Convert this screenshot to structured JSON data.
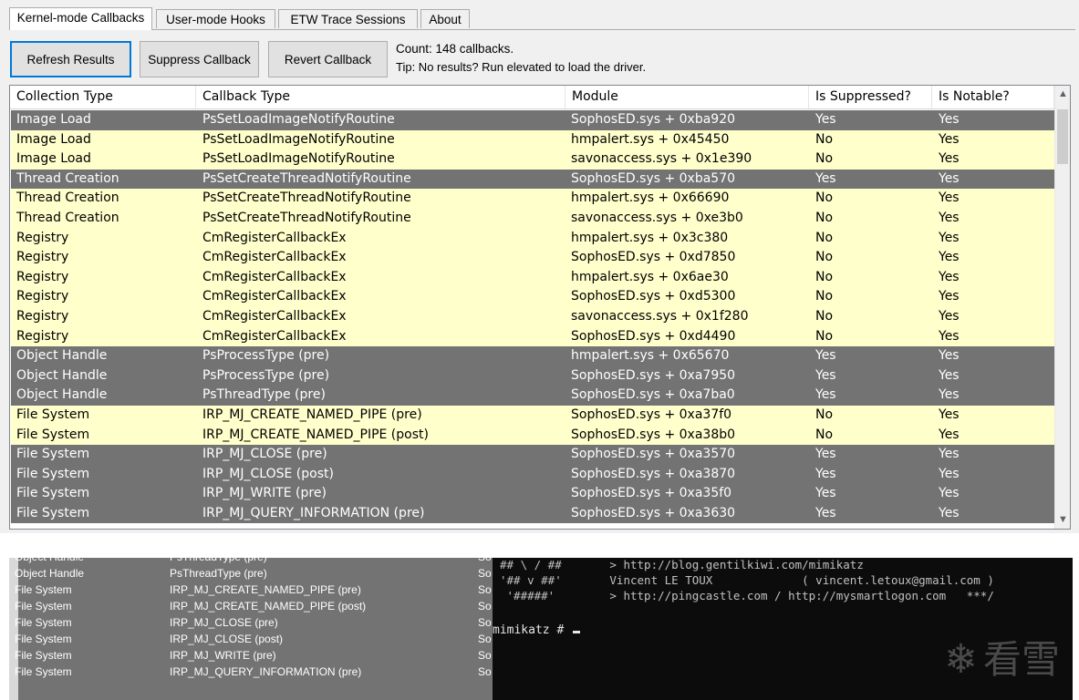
{
  "tabs": [
    "Kernel-mode Callbacks",
    "User-mode Hooks",
    "ETW Trace Sessions",
    "About"
  ],
  "toolbar": {
    "refresh_label": "Refresh Results",
    "suppress_label": "Suppress Callback",
    "revert_label": "Revert Callback",
    "count_text": "Count: 148 callbacks.",
    "tip_text": "Tip: No results? Run elevated to load the driver."
  },
  "columns": [
    "Collection Type",
    "Callback Type",
    "Module",
    "Is Suppressed?",
    "Is Notable?"
  ],
  "colors": {
    "highlight_row": "#737373",
    "notable_row": "#ffffcc"
  },
  "rows": [
    {
      "collection": "Image Load",
      "callback": "PsSetLoadImageNotifyRoutine",
      "module": "SophosED.sys + 0xba920",
      "suppressed": "Yes",
      "notable": "Yes",
      "shade": "dark"
    },
    {
      "collection": "Image Load",
      "callback": "PsSetLoadImageNotifyRoutine",
      "module": "hmpalert.sys + 0x45450",
      "suppressed": "No",
      "notable": "Yes",
      "shade": "light"
    },
    {
      "collection": "Image Load",
      "callback": "PsSetLoadImageNotifyRoutine",
      "module": "savonaccess.sys + 0x1e390",
      "suppressed": "No",
      "notable": "Yes",
      "shade": "light"
    },
    {
      "collection": "Thread Creation",
      "callback": "PsSetCreateThreadNotifyRoutine",
      "module": "SophosED.sys + 0xba570",
      "suppressed": "Yes",
      "notable": "Yes",
      "shade": "dark"
    },
    {
      "collection": "Thread Creation",
      "callback": "PsSetCreateThreadNotifyRoutine",
      "module": "hmpalert.sys + 0x66690",
      "suppressed": "No",
      "notable": "Yes",
      "shade": "light"
    },
    {
      "collection": "Thread Creation",
      "callback": "PsSetCreateThreadNotifyRoutine",
      "module": "savonaccess.sys + 0xe3b0",
      "suppressed": "No",
      "notable": "Yes",
      "shade": "light"
    },
    {
      "collection": "Registry",
      "callback": "CmRegisterCallbackEx",
      "module": "hmpalert.sys + 0x3c380",
      "suppressed": "No",
      "notable": "Yes",
      "shade": "light"
    },
    {
      "collection": "Registry",
      "callback": "CmRegisterCallbackEx",
      "module": "SophosED.sys + 0xd7850",
      "suppressed": "No",
      "notable": "Yes",
      "shade": "light"
    },
    {
      "collection": "Registry",
      "callback": "CmRegisterCallbackEx",
      "module": "hmpalert.sys + 0x6ae30",
      "suppressed": "No",
      "notable": "Yes",
      "shade": "light"
    },
    {
      "collection": "Registry",
      "callback": "CmRegisterCallbackEx",
      "module": "SophosED.sys + 0xd5300",
      "suppressed": "No",
      "notable": "Yes",
      "shade": "light"
    },
    {
      "collection": "Registry",
      "callback": "CmRegisterCallbackEx",
      "module": "savonaccess.sys + 0x1f280",
      "suppressed": "No",
      "notable": "Yes",
      "shade": "light"
    },
    {
      "collection": "Registry",
      "callback": "CmRegisterCallbackEx",
      "module": "SophosED.sys + 0xd4490",
      "suppressed": "No",
      "notable": "Yes",
      "shade": "light"
    },
    {
      "collection": "Object Handle",
      "callback": "PsProcessType (pre)",
      "module": "hmpalert.sys + 0x65670",
      "suppressed": "Yes",
      "notable": "Yes",
      "shade": "dark"
    },
    {
      "collection": "Object Handle",
      "callback": "PsProcessType (pre)",
      "module": "SophosED.sys + 0xa7950",
      "suppressed": "Yes",
      "notable": "Yes",
      "shade": "dark"
    },
    {
      "collection": "Object Handle",
      "callback": "PsThreadType (pre)",
      "module": "SophosED.sys + 0xa7ba0",
      "suppressed": "Yes",
      "notable": "Yes",
      "shade": "dark"
    },
    {
      "collection": "File System",
      "callback": "IRP_MJ_CREATE_NAMED_PIPE (pre)",
      "module": "SophosED.sys + 0xa37f0",
      "suppressed": "No",
      "notable": "Yes",
      "shade": "light"
    },
    {
      "collection": "File System",
      "callback": "IRP_MJ_CREATE_NAMED_PIPE (post)",
      "module": "SophosED.sys + 0xa38b0",
      "suppressed": "No",
      "notable": "Yes",
      "shade": "light"
    },
    {
      "collection": "File System",
      "callback": "IRP_MJ_CLOSE (pre)",
      "module": "SophosED.sys + 0xa3570",
      "suppressed": "Yes",
      "notable": "Yes",
      "shade": "dark"
    },
    {
      "collection": "File System",
      "callback": "IRP_MJ_CLOSE (post)",
      "module": "SophosED.sys + 0xa3870",
      "suppressed": "Yes",
      "notable": "Yes",
      "shade": "dark"
    },
    {
      "collection": "File System",
      "callback": "IRP_MJ_WRITE (pre)",
      "module": "SophosED.sys + 0xa35f0",
      "suppressed": "Yes",
      "notable": "Yes",
      "shade": "dark"
    },
    {
      "collection": "File System",
      "callback": "IRP_MJ_QUERY_INFORMATION (pre)",
      "module": "SophosED.sys + 0xa3630",
      "suppressed": "Yes",
      "notable": "Yes",
      "shade": "dark"
    }
  ],
  "bottom_list": [
    {
      "collection": "Object Handle",
      "callback": "PsThreadType (pre)",
      "module_prefix": "So"
    },
    {
      "collection": "Object Handle",
      "callback": "PsThreadType (pre)",
      "module_prefix": "So"
    },
    {
      "collection": "File System",
      "callback": "IRP_MJ_CREATE_NAMED_PIPE (pre)",
      "module_prefix": "So"
    },
    {
      "collection": "File System",
      "callback": "IRP_MJ_CREATE_NAMED_PIPE (post)",
      "module_prefix": "So"
    },
    {
      "collection": "File System",
      "callback": "IRP_MJ_CLOSE (pre)",
      "module_prefix": "So"
    },
    {
      "collection": "File System",
      "callback": "IRP_MJ_CLOSE (post)",
      "module_prefix": "So"
    },
    {
      "collection": "File System",
      "callback": "IRP_MJ_WRITE (pre)",
      "module_prefix": "So"
    },
    {
      "collection": "File System",
      "callback": "IRP_MJ_QUERY_INFORMATION (pre)",
      "module_prefix": "So"
    }
  ],
  "terminal": {
    "lines": [
      "## \\ / ##       > http://blog.gentilkiwi.com/mimikatz",
      "'## v ##'       Vincent LE TOUX             ( vincent.letoux@gmail.com )",
      " '#####'        > http://pingcastle.com / http://mysmartlogon.com   ***/"
    ],
    "prompt": "mimikatz # "
  },
  "watermark": {
    "icon": "snowflake-icon",
    "text": "看雪"
  }
}
